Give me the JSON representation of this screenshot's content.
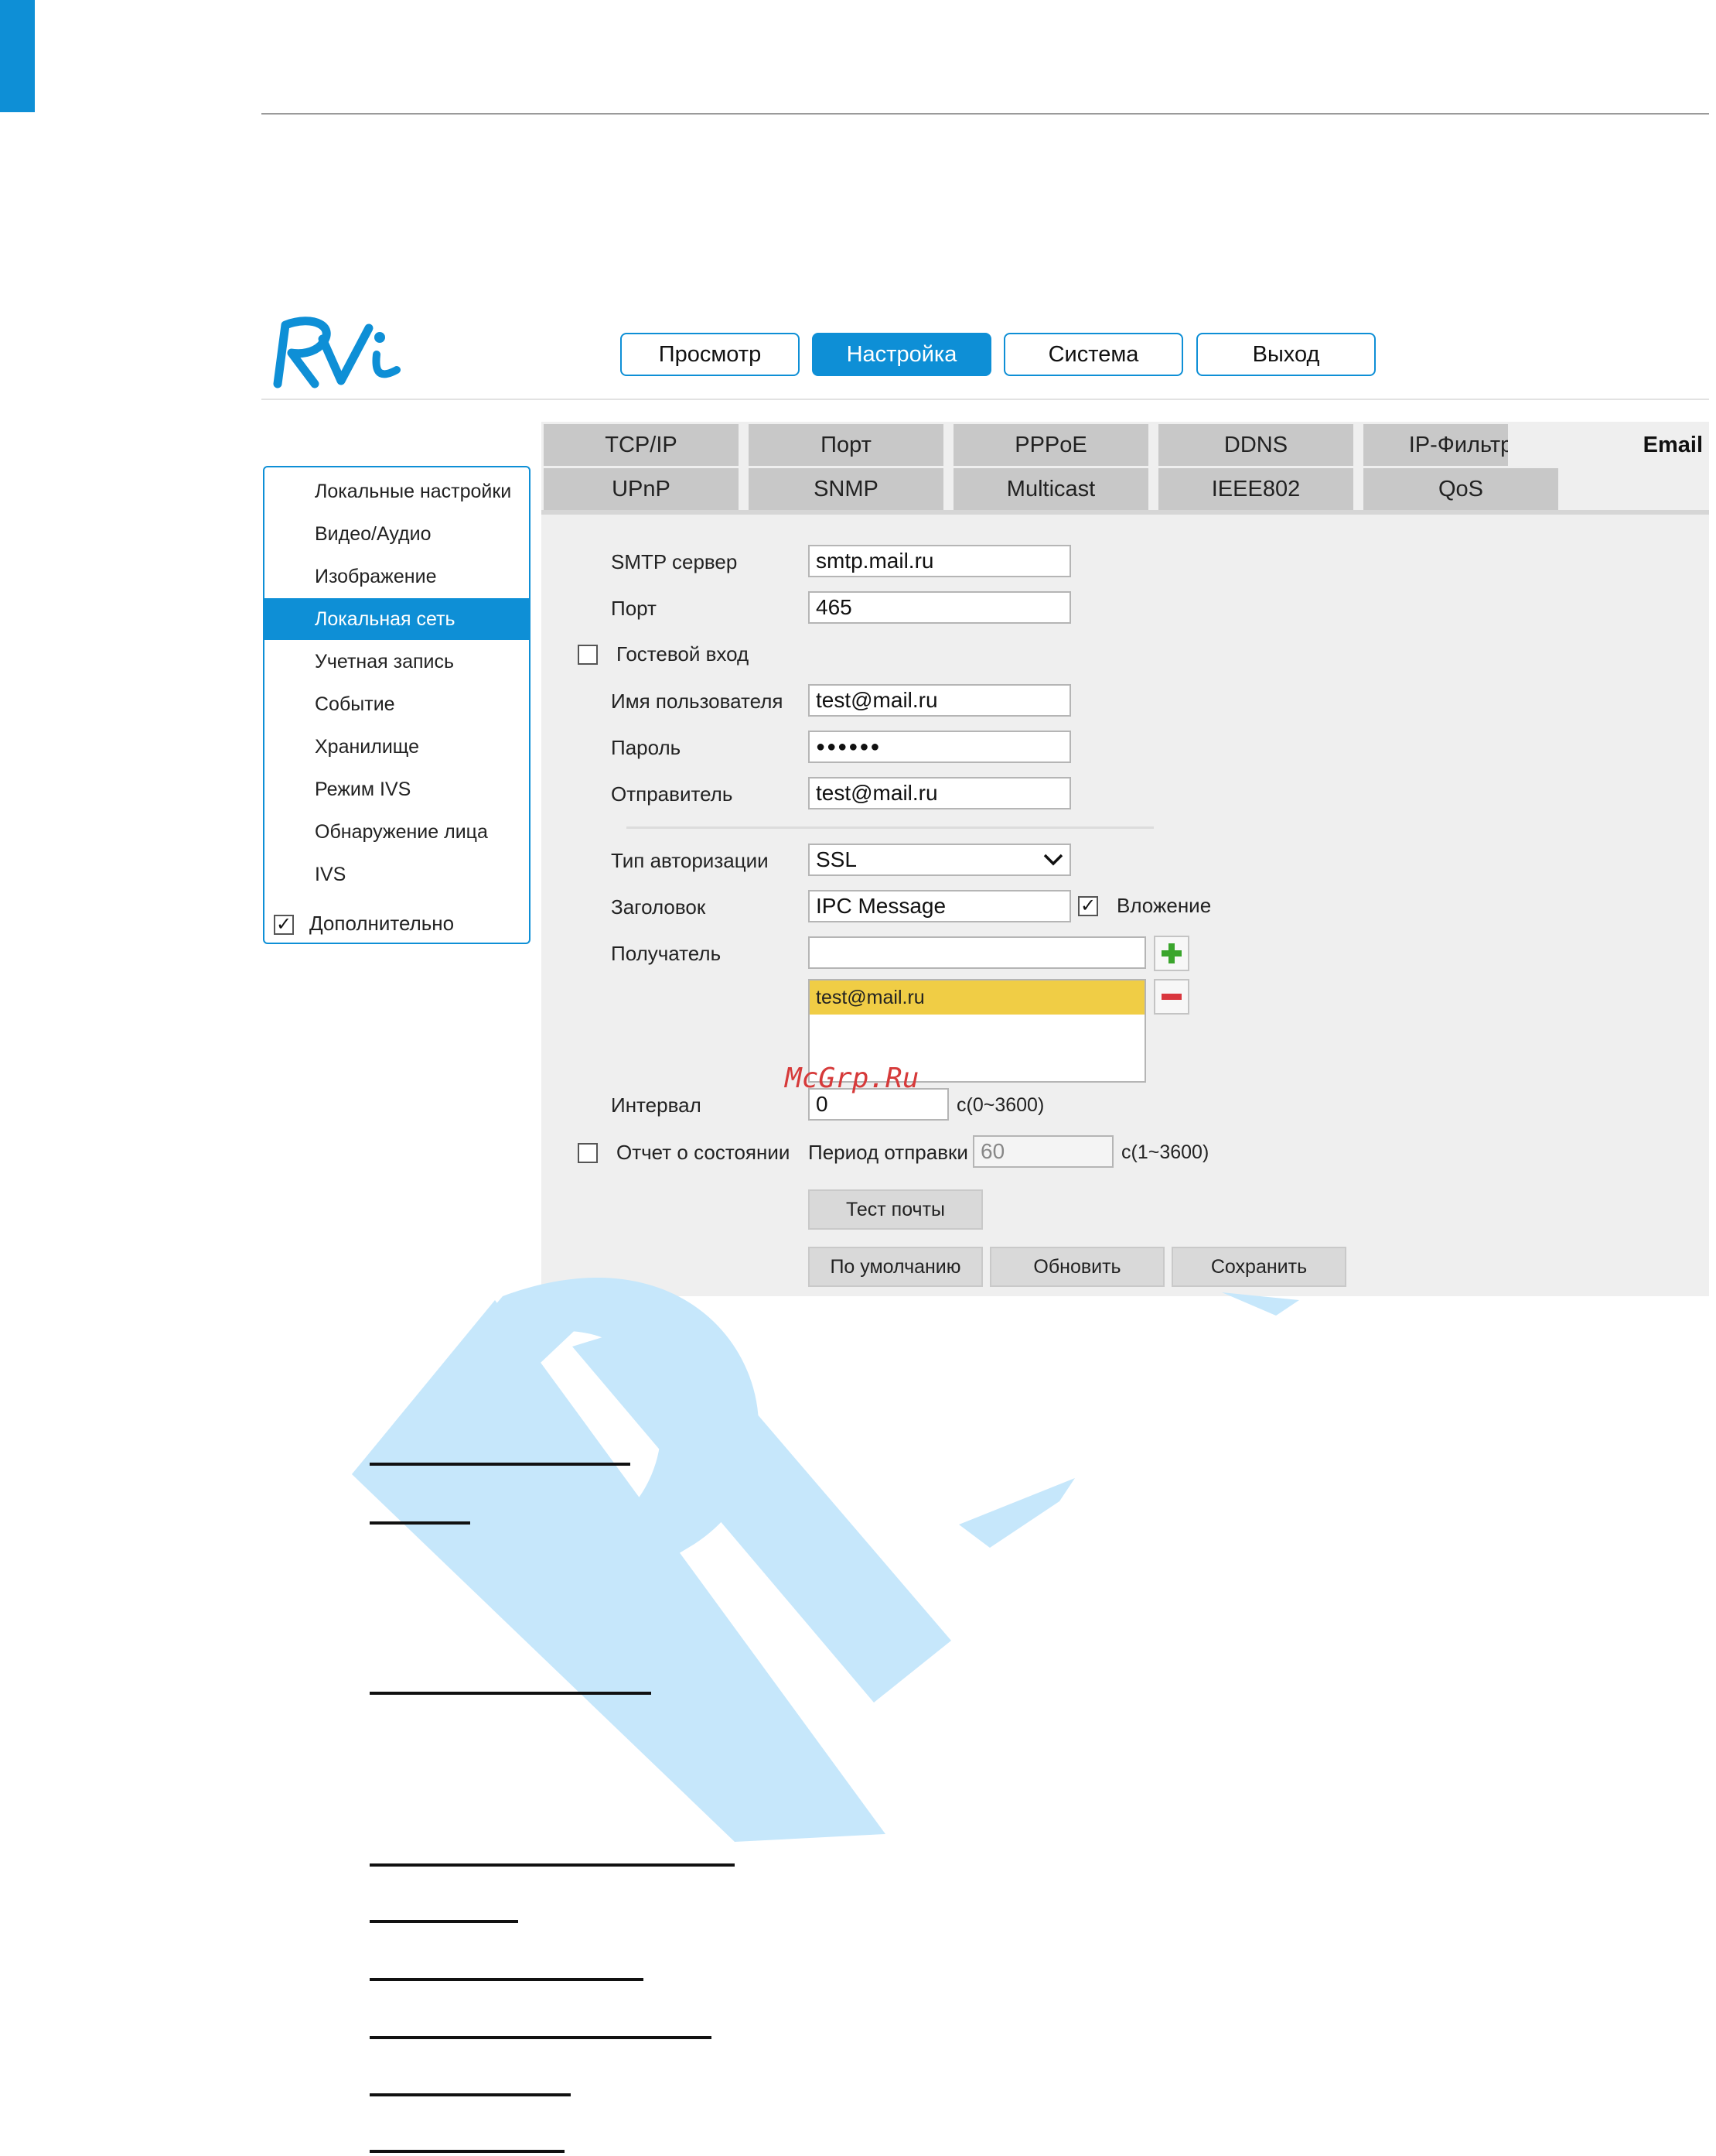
{
  "logo_text": "RVi",
  "nav": {
    "buttons": [
      "Просмотр",
      "Настройка",
      "Система",
      "Выход"
    ],
    "active": "Настройка"
  },
  "sidebar": {
    "items": [
      "Локальные настройки",
      "Видео/Аудио",
      "Изображение",
      "Локальная сеть",
      "Учетная запись",
      "Событие",
      "Хранилище",
      "Режим IVS",
      "Обнаружение лица",
      "IVS"
    ],
    "active": "Локальная сеть",
    "extra": {
      "label": "Дополнительно",
      "checked": true
    }
  },
  "tabs": {
    "row1": [
      "TCP/IP",
      "Порт",
      "PPPoE",
      "DDNS",
      "IP-Фильтр",
      "Email"
    ],
    "row2": [
      "UPnP",
      "SNMP",
      "Multicast",
      "IEEE802",
      "QoS"
    ],
    "active": "Email"
  },
  "form": {
    "smtp_label": "SMTP сервер",
    "smtp_value": "smtp.mail.ru",
    "port_label": "Порт",
    "port_value": "465",
    "guest_label": "Гостевой вход",
    "guest_checked": false,
    "user_label": "Имя пользователя",
    "user_value": "test@mail.ru",
    "password_label": "Пароль",
    "password_value": "●●●●●●",
    "sender_label": "Отправитель",
    "sender_value": "test@mail.ru",
    "auth_label": "Тип авторизации",
    "auth_value": "SSL",
    "subject_label": "Заголовок",
    "subject_value": "IPC Message",
    "attach_label": "Вложение",
    "attach_checked": true,
    "recipient_label": "Получатель",
    "recipient_value": "",
    "recipients": [
      "test@mail.ru"
    ],
    "interval_label": "Интервал",
    "interval_value": "0",
    "interval_hint": "с(0~3600)",
    "report_label": "Отчет о состоянии",
    "report_checked": false,
    "period_label": "Период отправки",
    "period_value": "60",
    "period_hint": "с(1~3600)"
  },
  "buttons": {
    "test": "Тест почты",
    "default": "По умолчанию",
    "refresh": "Обновить",
    "save": "Сохранить"
  },
  "watermark_text": "McGrp.Ru",
  "colors": {
    "accent": "#0e8fd6",
    "highlight": "#f0cd45",
    "watermark": "#c6e7fb"
  }
}
